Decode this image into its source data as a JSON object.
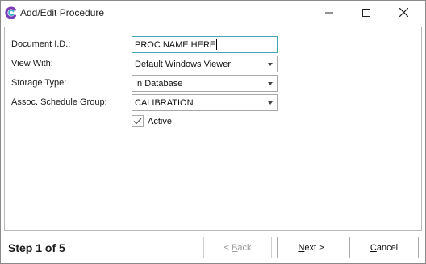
{
  "window": {
    "title": "Add/Edit Procedure",
    "icons": {
      "app": "app-logo-icon",
      "minimize": "minimize-icon",
      "maximize": "maximize-icon",
      "close": "close-icon"
    }
  },
  "form": {
    "document_id": {
      "label": "Document I.D.:",
      "value": "PROC NAME HERE"
    },
    "view_with": {
      "label": "View With:",
      "value": "Default Windows Viewer"
    },
    "storage_type": {
      "label": "Storage Type:",
      "value": "In Database"
    },
    "schedule_group": {
      "label": "Assoc. Schedule Group:",
      "value": "CALIBRATION"
    },
    "active": {
      "label": "Active",
      "checked": true
    }
  },
  "footer": {
    "step": "Step 1 of 5",
    "back": {
      "pre": "< ",
      "mnemonic": "B",
      "rest": "ack",
      "enabled": false
    },
    "next": {
      "mnemonic": "N",
      "rest": "ext >"
    },
    "cancel": {
      "mnemonic": "C",
      "rest": "ancel"
    }
  },
  "colors": {
    "accent_border": "#47a3b8",
    "logo": "#7b3fb5"
  }
}
